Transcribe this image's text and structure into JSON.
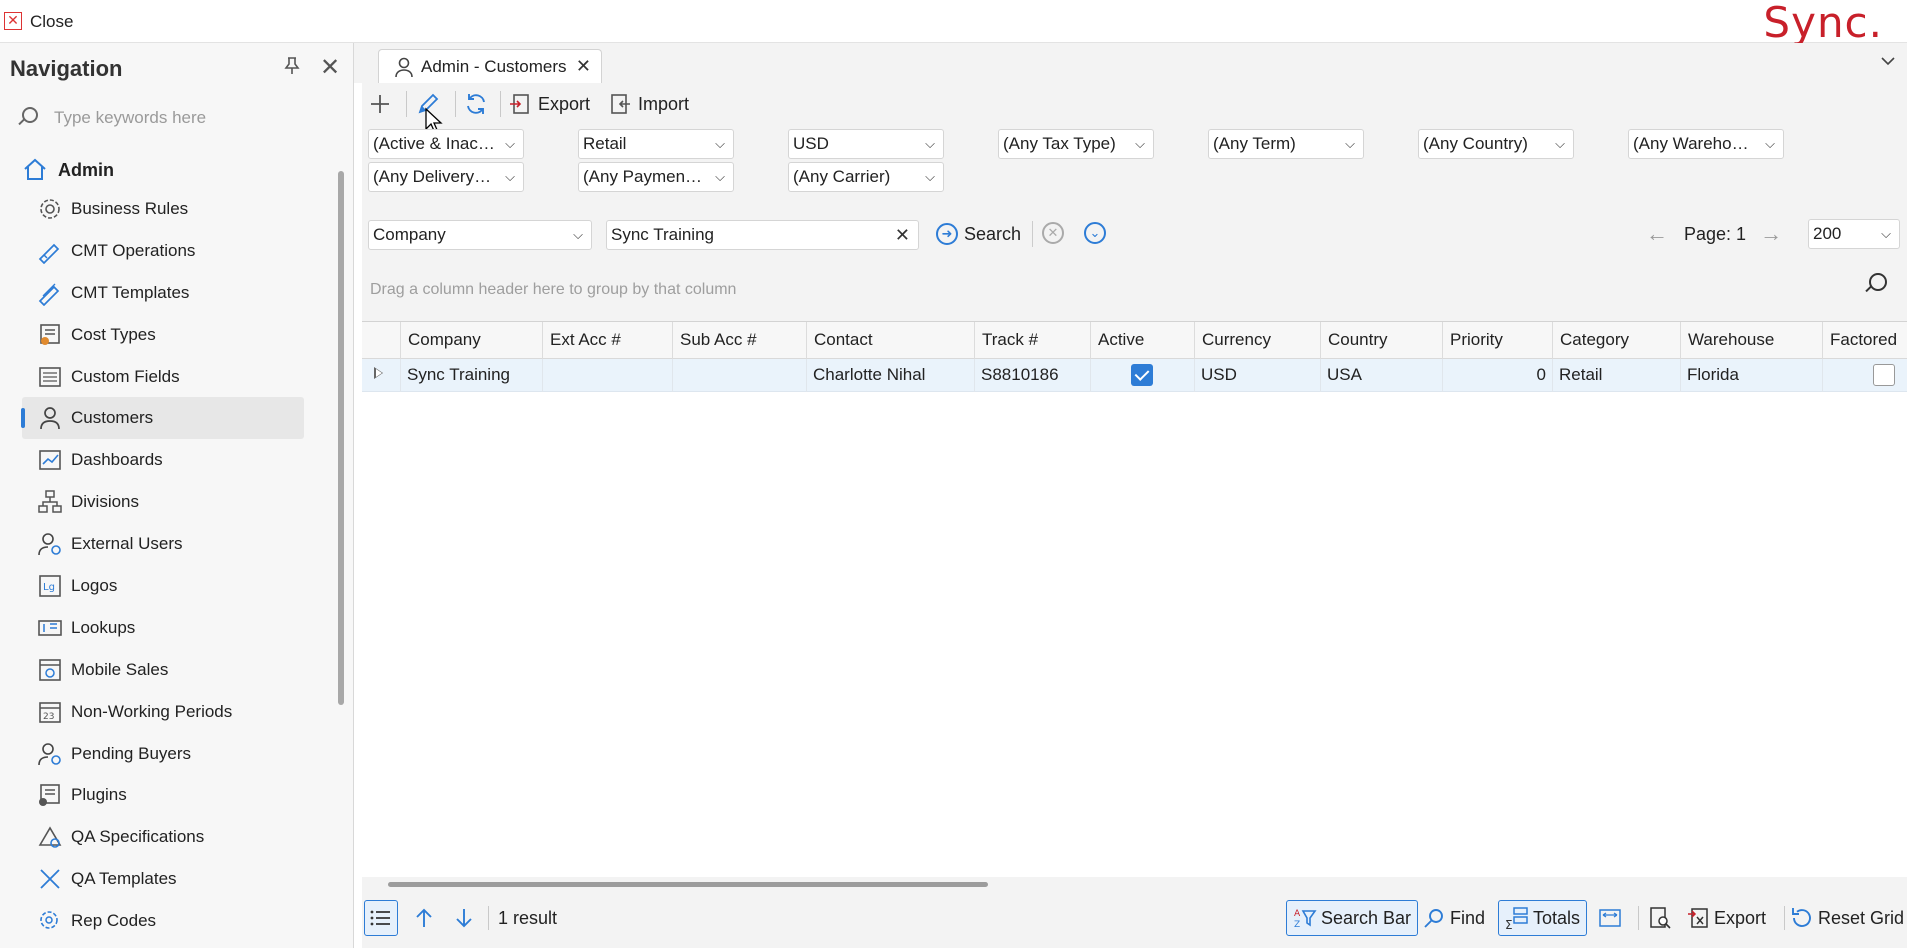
{
  "window": {
    "close_label": "Close",
    "brand": "Sync.",
    "brand_color": "#c8202a",
    "accent_color": "#2d7cd6"
  },
  "navigation": {
    "title": "Navigation",
    "search_placeholder": "Type keywords here",
    "root_label": "Admin",
    "items": [
      {
        "label": "Business Rules",
        "icon": "gear-icon"
      },
      {
        "label": "CMT Operations",
        "icon": "tag-icon"
      },
      {
        "label": "CMT Templates",
        "icon": "tags-icon"
      },
      {
        "label": "Cost Types",
        "icon": "cost-types-icon"
      },
      {
        "label": "Custom Fields",
        "icon": "custom-fields-icon"
      },
      {
        "label": "Customers",
        "icon": "customer-icon",
        "selected": true
      },
      {
        "label": "Dashboards",
        "icon": "dashboard-icon"
      },
      {
        "label": "Divisions",
        "icon": "divisions-icon"
      },
      {
        "label": "External Users",
        "icon": "external-users-icon"
      },
      {
        "label": "Logos",
        "icon": "logo-icon"
      },
      {
        "label": "Lookups",
        "icon": "lookups-icon"
      },
      {
        "label": "Mobile Sales",
        "icon": "mobile-sales-icon"
      },
      {
        "label": "Non-Working Periods",
        "icon": "calendar-icon"
      },
      {
        "label": "Pending Buyers",
        "icon": "pending-buyers-icon"
      },
      {
        "label": "Plugins",
        "icon": "plugins-icon"
      },
      {
        "label": "QA Specifications",
        "icon": "qa-specifications-icon"
      },
      {
        "label": "QA Templates",
        "icon": "qa-templates-icon"
      },
      {
        "label": "Rep Codes",
        "icon": "rep-codes-icon"
      }
    ]
  },
  "tab": {
    "label": "Admin - Customers"
  },
  "toolbar": {
    "export_label": "Export",
    "import_label": "Import"
  },
  "filters": {
    "row1": [
      "(Active & Inactive)",
      "Retail",
      "USD",
      "(Any Tax Type)",
      "(Any Term)",
      "(Any Country)",
      "(Any Warehouse)"
    ],
    "row2": [
      "(Any Delivery Meth...",
      "(Any Payment Meth...",
      "(Any Carrier)"
    ]
  },
  "search": {
    "field": "Company",
    "value": "Sync Training",
    "button_label": "Search",
    "page_label": "Page: 1",
    "page_size": "200"
  },
  "grid": {
    "group_hint": "Drag a column header here to group by that column",
    "columns": [
      "Company",
      "Ext Acc #",
      "Sub Acc #",
      "Contact",
      "Track #",
      "Active",
      "Currency",
      "Country",
      "Priority",
      "Category",
      "Warehouse",
      "Factored"
    ],
    "rows": [
      {
        "company": "Sync Training",
        "ext_acc": "",
        "sub_acc": "",
        "contact": "Charlotte Nihal",
        "track": "S8810186",
        "active": true,
        "currency": "USD",
        "country": "USA",
        "priority": "0",
        "category": "Retail",
        "warehouse": "Florida",
        "factored": false
      }
    ]
  },
  "status": {
    "result_count": "1 result",
    "search_bar_label": "Search Bar",
    "find_label": "Find",
    "totals_label": "Totals",
    "export_label": "Export",
    "reset_grid_label": "Reset Grid"
  }
}
